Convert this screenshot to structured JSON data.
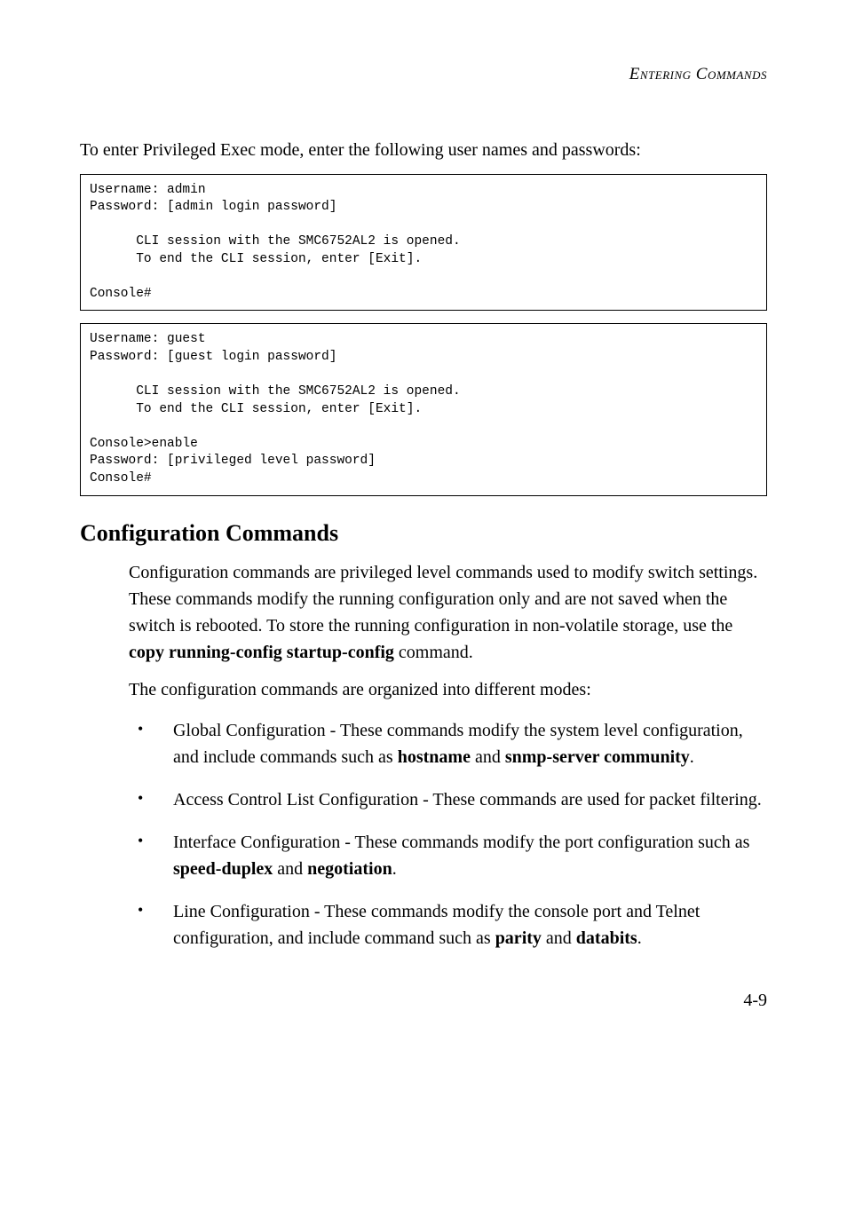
{
  "header": {
    "section_title": "Entering Commands"
  },
  "intro": {
    "text": "To enter Privileged Exec mode, enter the following user names and passwords:"
  },
  "code1": "Username: admin\nPassword: [admin login password]\n\n      CLI session with the SMC6752AL2 is opened.\n      To end the CLI session, enter [Exit].\n\nConsole#",
  "code2": "Username: guest\nPassword: [guest login password]\n\n      CLI session with the SMC6752AL2 is opened.\n      To end the CLI session, enter [Exit].\n\nConsole>enable\nPassword: [privileged level password]\nConsole#",
  "config": {
    "heading": "Configuration Commands",
    "p1_a": "Configuration commands are privileged level commands used to modify switch settings. These commands modify the running configuration only and are not saved when the switch is rebooted. To store the running configuration in non-volatile storage, use the ",
    "p1_b1": "copy running-config startup-config",
    "p1_c": " command.",
    "p2": "The configuration commands are organized into different modes:",
    "items": {
      "i0": {
        "pre": "Global Configuration - These commands modify the system level configuration, and include commands such as ",
        "b1": "hostname",
        "mid": " and ",
        "b2": "snmp-server community",
        "post": "."
      },
      "i1": {
        "full": "Access Control List Configuration - These commands are used for packet filtering."
      },
      "i2": {
        "pre": "Interface Configuration - These commands modify the port configuration such as ",
        "b1": "speed-duplex",
        "mid": " and ",
        "b2": "negotiation",
        "post": "."
      },
      "i3": {
        "pre": "Line Configuration - These commands modify the console port and Telnet configuration, and include command such as ",
        "b1": "parity",
        "mid": " and ",
        "b2": "databits",
        "post": "."
      }
    }
  },
  "page_number": "4-9"
}
